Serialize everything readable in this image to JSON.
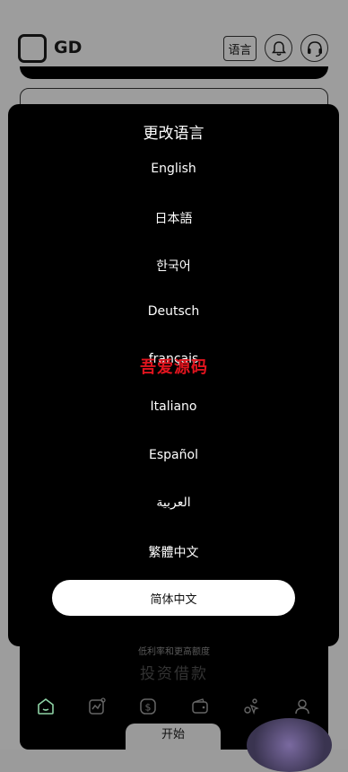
{
  "header": {
    "brand": "GD",
    "lang_button": "语言"
  },
  "modal": {
    "title": "更改语言",
    "languages": [
      "English",
      "日本語",
      "한국어",
      "Deutsch",
      "français",
      "Italiano",
      "Español",
      "العربية",
      "繁體中文"
    ],
    "selected": "简体中文"
  },
  "watermark": "吾爱源码",
  "bottom": {
    "subtitle": "低利率和更高额度",
    "headline": "投资借款",
    "start_button": "开始"
  },
  "colors": {
    "modal_bg": "#000000",
    "watermark": "#e0141e",
    "selected_bg": "#ffffff"
  }
}
